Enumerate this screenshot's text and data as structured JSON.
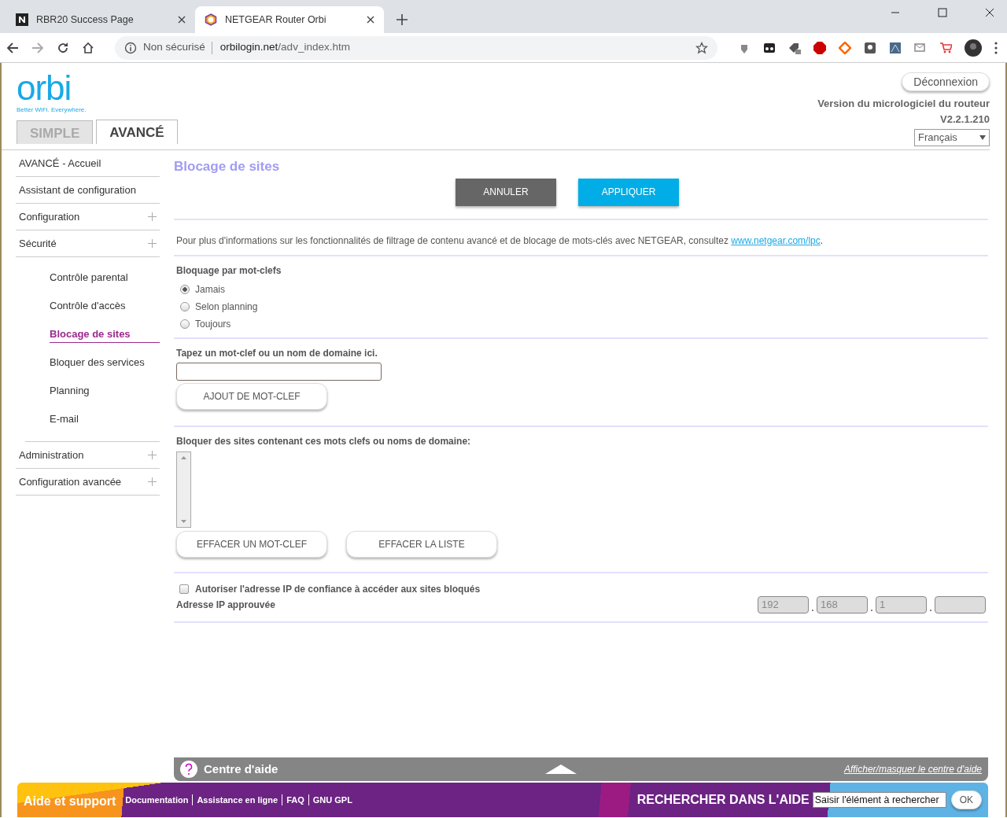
{
  "browser": {
    "tabs": [
      {
        "title": "RBR20 Success Page",
        "selected": false
      },
      {
        "title": "NETGEAR Router Orbi",
        "selected": true
      }
    ],
    "address": {
      "security": "Non sécurisé",
      "host": "orbilogin.net",
      "path": "/adv_index.htm"
    }
  },
  "header": {
    "logo": "orbi",
    "tagline": "Better WiFi. Everywhere.",
    "logout": "Déconnexion",
    "firmware_label": "Version du micrologiciel du routeur",
    "firmware_version": "V2.2.1.210",
    "language": "Français"
  },
  "mode_tabs": [
    {
      "label": "SIMPLE",
      "selected": false
    },
    {
      "label": "AVANCÉ",
      "selected": true
    }
  ],
  "sidebar": {
    "items": [
      {
        "label": "AVANCÉ - Accueil",
        "expandable": false
      },
      {
        "label": "Assistant de configuration",
        "expandable": false
      },
      {
        "label": "Configuration",
        "expandable": true
      },
      {
        "label": "Sécurité",
        "expandable": true,
        "children": [
          {
            "label": "Contrôle parental",
            "selected": false
          },
          {
            "label": "Contrôle d'accès",
            "selected": false
          },
          {
            "label": "Blocage de sites",
            "selected": true
          },
          {
            "label": "Bloquer des services",
            "selected": false
          },
          {
            "label": "Planning",
            "selected": false
          },
          {
            "label": "E-mail",
            "selected": false
          }
        ]
      },
      {
        "label": "Administration",
        "expandable": true
      },
      {
        "label": "Configuration avancée",
        "expandable": true
      }
    ]
  },
  "content": {
    "title": "Blocage de sites",
    "cancel": "ANNULER",
    "apply": "APPLIQUER",
    "info": "Pour plus d'informations sur les fonctionnalités de filtrage de contenu avancé et de blocage de mots-clés avec NETGEAR, consultez ",
    "info_link": "www.netgear.com/lpc",
    "info_end": ".",
    "blocking_label": "Bloquage par mot-clefs",
    "blocking_options": [
      {
        "label": "Jamais",
        "selected": true
      },
      {
        "label": "Selon planning",
        "selected": false
      },
      {
        "label": "Toujours",
        "selected": false
      }
    ],
    "keyword_label": "Tapez un mot-clef ou un nom de domaine ici.",
    "add_button": "AJOUT DE MOT-CLEF",
    "list_label": "Bloquer des sites contenant ces mots clefs ou noms de domaine:",
    "delete_one": "EFFACER UN MOT-CLEF",
    "delete_all": "EFFACER LA LISTE",
    "trusted": {
      "label": "Autoriser l'adresse IP de confiance à accéder aux sites bloqués",
      "checked": false
    },
    "approved_label": "Adresse IP approuvée",
    "ip_octets": [
      "192",
      "168",
      "1"
    ]
  },
  "help_bar": {
    "title": "Centre d'aide",
    "toggle": "Afficher/masquer le centre d'aide"
  },
  "footer": {
    "title": "Aide et support",
    "links": [
      "Documentation",
      "Assistance en ligne",
      "FAQ",
      "GNU GPL"
    ],
    "search_label": "RECHERCHER DANS L'AIDE",
    "search_placeholder": "Saisir l'élément à rechercher",
    "ok": "OK"
  }
}
